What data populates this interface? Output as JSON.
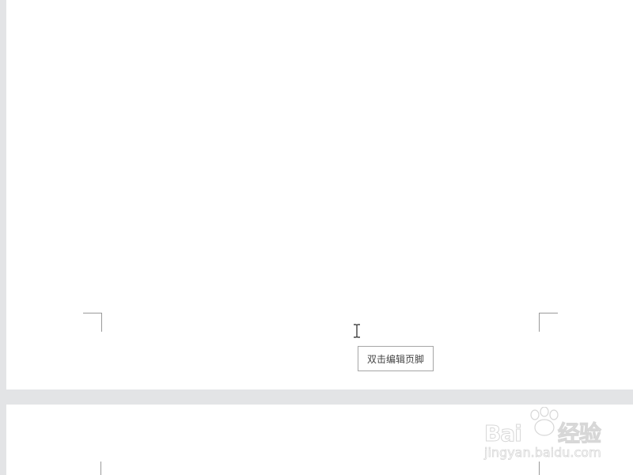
{
  "document": {
    "footer_hint": "双击编辑页脚"
  },
  "watermark": {
    "logo": "Bai",
    "logo_suffix": "经验",
    "url": "jingyan.baidu.com"
  },
  "colors": {
    "canvas_gray": "#e3e4e6",
    "page": "#ffffff",
    "crop_mark": "#9a9a9a",
    "tooltip_border": "#a6a6a6",
    "tooltip_text": "#444444"
  }
}
